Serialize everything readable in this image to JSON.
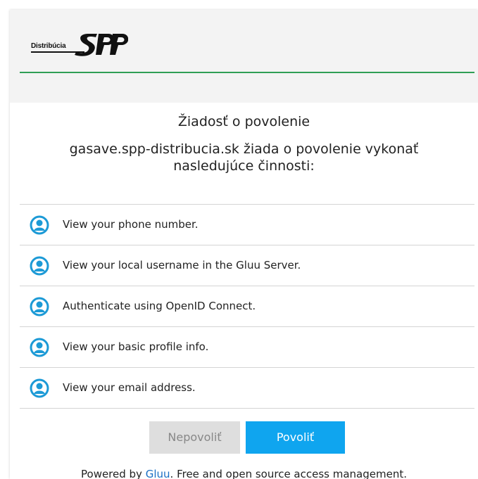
{
  "header": {
    "logo_text": "Distribúcia",
    "logo_mark": "SPP"
  },
  "title": "Žiadosť o povolenie",
  "subtitle": "gasave.spp-distribucia.sk žiada o povolenie vykonať nasledujúce činnosti:",
  "permissions": [
    {
      "icon": "user-icon",
      "label": "View your phone number."
    },
    {
      "icon": "user-icon",
      "label": "View your local username in the Gluu Server."
    },
    {
      "icon": "user-icon",
      "label": "Authenticate using OpenID Connect."
    },
    {
      "icon": "user-icon",
      "label": "View your basic profile info."
    },
    {
      "icon": "user-icon",
      "label": "View your email address."
    }
  ],
  "buttons": {
    "deny_label": "Nepovoliť",
    "allow_label": "Povoliť"
  },
  "footer": {
    "prefix": "Powered by ",
    "link_text": "Gluu",
    "suffix": ". Free and open source access management."
  },
  "colors": {
    "accent": "#0fa5ef",
    "brand_line": "#2f9e55",
    "icon": "#1c9ad6",
    "deny_bg": "#dedede",
    "link": "#1a6fc4"
  }
}
